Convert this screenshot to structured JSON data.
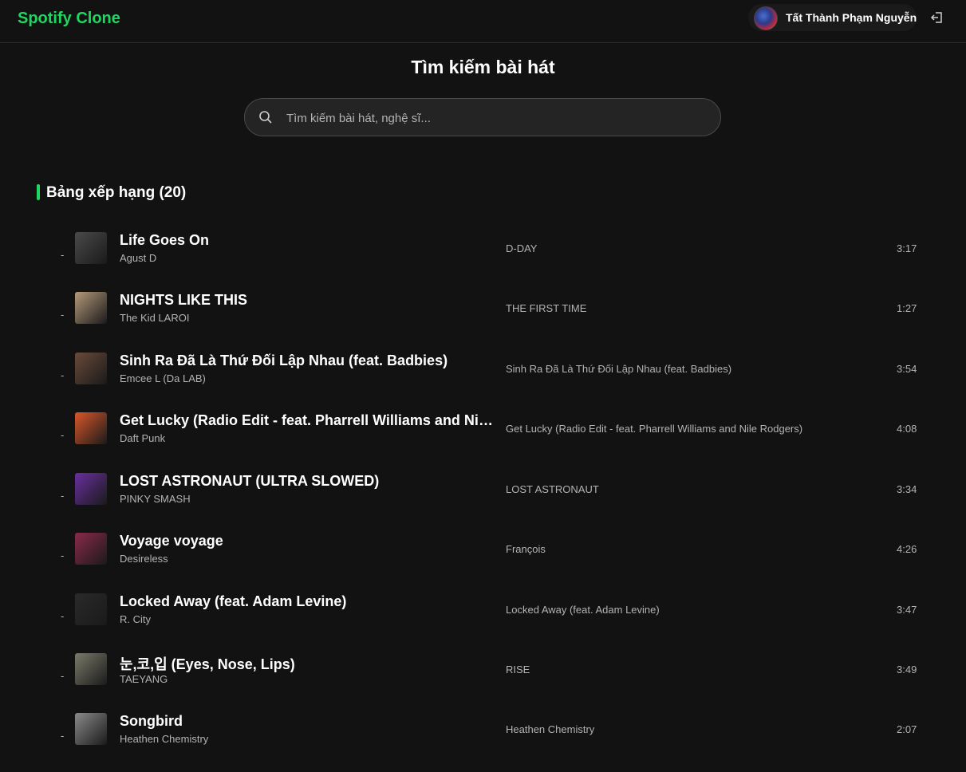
{
  "brand": "Spotify Clone",
  "user": {
    "name": "Tất Thành Phạm Nguyễn"
  },
  "page": {
    "title": "Tìm kiếm bài hát"
  },
  "search": {
    "placeholder": "Tìm kiếm bài hát, nghệ sĩ..."
  },
  "section": {
    "title": "Bảng xếp hạng (20)"
  },
  "tracks": [
    {
      "rank": "-",
      "title": "Life Goes On",
      "artist": "Agust D",
      "album": "D-DAY",
      "duration": "3:17",
      "cover": "#4a4a4a"
    },
    {
      "rank": "-",
      "title": "NIGHTS LIKE THIS",
      "artist": "The Kid LAROI",
      "album": "THE FIRST TIME",
      "duration": "1:27",
      "cover": "#b59a7a"
    },
    {
      "rank": "-",
      "title": "Sinh Ra Đã Là Thứ Đối Lập Nhau (feat. Badbies)",
      "artist": "Emcee L (Da LAB)",
      "album": "Sinh Ra Đã Là Thứ Đối Lập Nhau (feat. Badbies)",
      "duration": "3:54",
      "cover": "#6a4a3a"
    },
    {
      "rank": "-",
      "title": "Get Lucky (Radio Edit - feat. Pharrell Williams and Nile Rodgers)",
      "artist": "Daft Punk",
      "album": "Get Lucky (Radio Edit - feat. Pharrell Williams and Nile Rodgers)",
      "duration": "4:08",
      "cover": "#d9572a"
    },
    {
      "rank": "-",
      "title": "LOST ASTRONAUT (ULTRA SLOWED)",
      "artist": "PINKY SMASH",
      "album": "LOST ASTRONAUT",
      "duration": "3:34",
      "cover": "#6a2fa0"
    },
    {
      "rank": "-",
      "title": "Voyage voyage",
      "artist": "Desireless",
      "album": "François",
      "duration": "4:26",
      "cover": "#8a2a4a"
    },
    {
      "rank": "-",
      "title": "Locked Away (feat. Adam Levine)",
      "artist": "R. City",
      "album": "Locked Away (feat. Adam Levine)",
      "duration": "3:47",
      "cover": "#2a2a2a"
    },
    {
      "rank": "-",
      "title": "눈,코,입 (Eyes, Nose, Lips)",
      "artist": "TAEYANG",
      "album": "RISE",
      "duration": "3:49",
      "cover": "#7a7a6a"
    },
    {
      "rank": "-",
      "title": "Songbird",
      "artist": "Heathen Chemistry",
      "album": "Heathen Chemistry",
      "duration": "2:07",
      "cover": "#8a8a8a"
    }
  ]
}
